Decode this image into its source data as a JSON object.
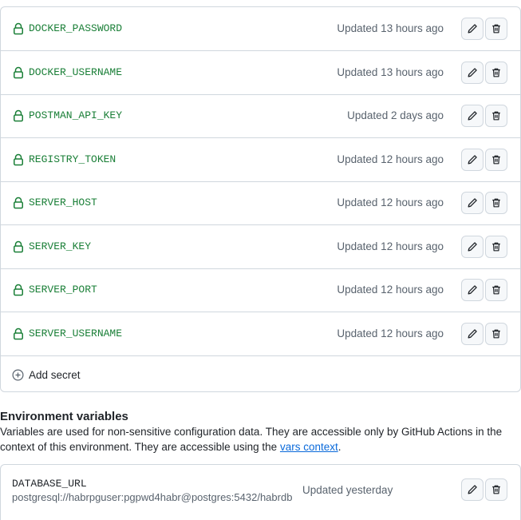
{
  "secrets": {
    "items": [
      {
        "name": "DOCKER_PASSWORD",
        "updated": "Updated 13 hours ago"
      },
      {
        "name": "DOCKER_USERNAME",
        "updated": "Updated 13 hours ago"
      },
      {
        "name": "POSTMAN_API_KEY",
        "updated": "Updated 2 days ago"
      },
      {
        "name": "REGISTRY_TOKEN",
        "updated": "Updated 12 hours ago"
      },
      {
        "name": "SERVER_HOST",
        "updated": "Updated 12 hours ago"
      },
      {
        "name": "SERVER_KEY",
        "updated": "Updated 12 hours ago"
      },
      {
        "name": "SERVER_PORT",
        "updated": "Updated 12 hours ago"
      },
      {
        "name": "SERVER_USERNAME",
        "updated": "Updated 12 hours ago"
      }
    ],
    "add_label": "Add secret"
  },
  "env": {
    "heading": "Environment variables",
    "desc_before": "Variables are used for non-sensitive configuration data. They are accessible only by GitHub Actions in the context of this environment. They are accessible using the ",
    "desc_link": "vars context",
    "desc_after": ".",
    "variables": [
      {
        "name": "DATABASE_URL",
        "value": "postgresql://habrpguser:pgpwd4habr@postgres:5432/habrdb",
        "updated": "Updated yesterday"
      }
    ]
  },
  "colors": {
    "secret_name": "#1a7f37",
    "muted": "#59636e",
    "link": "#0969da",
    "border": "#d0d7de"
  },
  "icons": {
    "lock": "lock-icon",
    "edit": "pencil-icon",
    "delete": "trash-icon",
    "add": "plus-circle-icon"
  }
}
